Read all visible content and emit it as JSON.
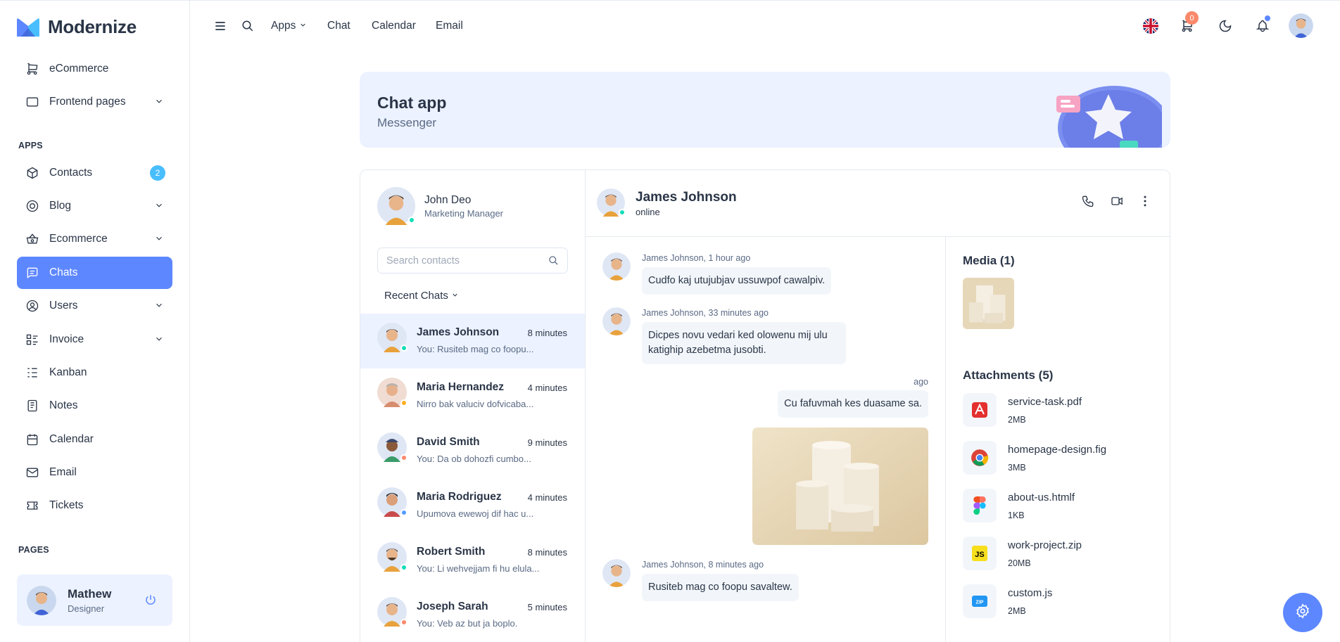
{
  "app": {
    "brand": "Modernize"
  },
  "sidebar": {
    "items_top": [
      {
        "label": "eCommerce",
        "icon": "cart-icon"
      },
      {
        "label": "Frontend pages",
        "icon": "layout-icon"
      }
    ],
    "apps_label": "APPS",
    "apps": [
      {
        "label": "Contacts",
        "icon": "box-icon",
        "badge": "2"
      },
      {
        "label": "Blog",
        "icon": "blog-icon"
      },
      {
        "label": "Ecommerce",
        "icon": "basket-icon"
      },
      {
        "label": "Chats",
        "icon": "message-icon"
      },
      {
        "label": "Users",
        "icon": "user-circle-icon"
      },
      {
        "label": "Invoice",
        "icon": "list-details-icon"
      },
      {
        "label": "Kanban",
        "icon": "kanban-icon"
      },
      {
        "label": "Notes",
        "icon": "notes-icon"
      },
      {
        "label": "Calendar",
        "icon": "calendar-icon"
      },
      {
        "label": "Email",
        "icon": "mail-icon"
      },
      {
        "label": "Tickets",
        "icon": "ticket-icon"
      }
    ],
    "pages_label": "PAGES",
    "user": {
      "name": "Mathew",
      "role": "Designer"
    }
  },
  "topbar": {
    "links": [
      "Apps",
      "Chat",
      "Calendar",
      "Email"
    ],
    "cart_count": "0"
  },
  "banner": {
    "title": "Chat app",
    "subtitle": "Messenger"
  },
  "contacts": {
    "me": {
      "name": "John Deo",
      "role": "Marketing Manager"
    },
    "search_placeholder": "Search contacts",
    "recent_label": "Recent Chats",
    "list": [
      {
        "name": "James Johnson",
        "time": "8 minutes",
        "preview": "You: Rusiteb mag co foopu...",
        "status": "#13deb9"
      },
      {
        "name": "Maria Hernandez",
        "time": "4 minutes",
        "preview": "Nirro bak valuciv dofvicaba...",
        "status": "#ffae1f"
      },
      {
        "name": "David Smith",
        "time": "9 minutes",
        "preview": "You: Da ob dohozfi cumbo...",
        "status": "#fa896b"
      },
      {
        "name": "Maria Rodriguez",
        "time": "4 minutes",
        "preview": "Upumova ewewoj dif hac u...",
        "status": "#539bff"
      },
      {
        "name": "Robert Smith",
        "time": "8 minutes",
        "preview": "You: Li wehvejjam fi hu elula...",
        "status": "#13deb9"
      },
      {
        "name": "Joseph Sarah",
        "time": "5 minutes",
        "preview": "You: Veb az but ja boplo.",
        "status": "#fa896b"
      }
    ]
  },
  "conversation": {
    "name": "James Johnson",
    "status": "online",
    "messages": [
      {
        "meta": "James Johnson, 1 hour ago",
        "text": "Cudfo kaj utujubjav ussuwpof cawalpiv."
      },
      {
        "meta": "James Johnson, 33 minutes ago",
        "text": "Dicpes novu vedari ked olowenu mij ulu katighip azebetma jusobti."
      },
      {
        "meta": "ago",
        "text": "Cu fafuvmah kes duasame sa."
      },
      {
        "meta": "James Johnson, 8 minutes ago",
        "text": "Rusiteb mag co foopu savaltew."
      }
    ]
  },
  "media": {
    "media_title": "Media (1)",
    "attachments_title": "Attachments (5)",
    "files": [
      {
        "name": "service-task.pdf",
        "size": "2MB",
        "icon": "pdf-icon"
      },
      {
        "name": "homepage-design.fig",
        "size": "3MB",
        "icon": "chrome-icon"
      },
      {
        "name": "about-us.htmlf",
        "size": "1KB",
        "icon": "figma-icon"
      },
      {
        "name": "work-project.zip",
        "size": "20MB",
        "icon": "js-icon"
      },
      {
        "name": "custom.js",
        "size": "2MB",
        "icon": "zip-icon"
      }
    ]
  },
  "colors": {
    "primary": "#5d87ff",
    "light_primary": "#ecf2ff",
    "text": "#2a3547",
    "muted": "#5a6a85"
  }
}
